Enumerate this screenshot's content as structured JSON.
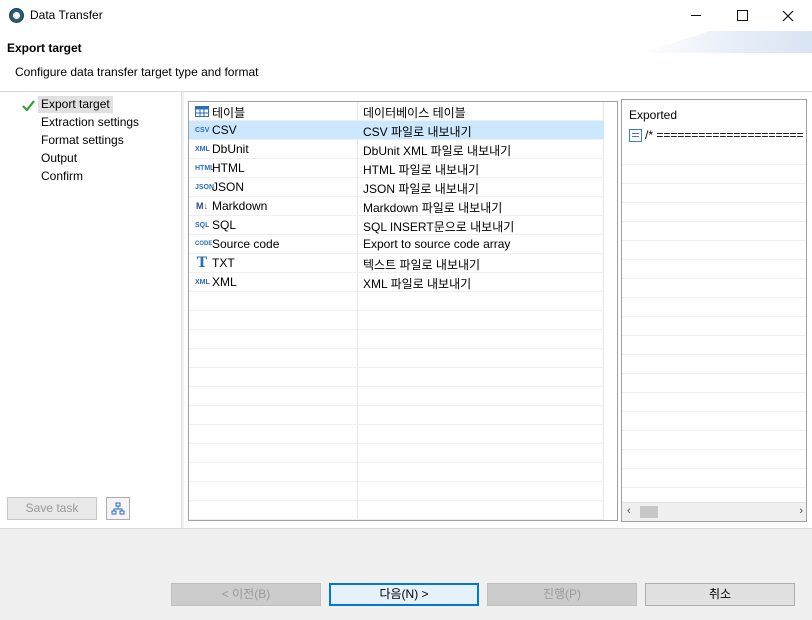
{
  "window": {
    "title": "Data Transfer"
  },
  "header": {
    "title": "Export target",
    "description": "Configure data transfer target type and format"
  },
  "steps": [
    {
      "label": "Export target",
      "active": true
    },
    {
      "label": "Extraction settings",
      "active": false
    },
    {
      "label": "Format settings",
      "active": false
    },
    {
      "label": "Output",
      "active": false
    },
    {
      "label": "Confirm",
      "active": false
    }
  ],
  "left_buttons": {
    "save_task": "Save task"
  },
  "formats": [
    {
      "icon": "table-icon",
      "name": "테이블",
      "description": "데이터베이스 테이블"
    },
    {
      "icon": "csv-icon",
      "name": "CSV",
      "description": "CSV 파일로 내보내기"
    },
    {
      "icon": "xml-icon",
      "name": "DbUnit",
      "description": "DbUnit XML 파일로 내보내기"
    },
    {
      "icon": "html-icon",
      "name": "HTML",
      "description": "HTML 파일로 내보내기"
    },
    {
      "icon": "json-icon",
      "name": "JSON",
      "description": "JSON 파일로 내보내기"
    },
    {
      "icon": "markdown-icon",
      "name": "Markdown",
      "description": "Markdown 파일로 내보내기"
    },
    {
      "icon": "sql-icon",
      "name": "SQL",
      "description": "SQL INSERT문으로 내보내기"
    },
    {
      "icon": "code-icon",
      "name": "Source code",
      "description": "Export to source code array"
    },
    {
      "icon": "txt-icon",
      "name": "TXT",
      "description": "텍스트 파일로 내보내기"
    },
    {
      "icon": "xml-icon",
      "name": "XML",
      "description": "XML 파일로 내보내기"
    }
  ],
  "selected_format": "CSV",
  "preview": {
    "label": "Exported",
    "item": "/* ====================="
  },
  "footer": {
    "back": "< 이전(B)",
    "next": "다음(N) >",
    "proceed": "진행(P)",
    "cancel": "취소"
  },
  "colors": {
    "selection": "#cce8ff",
    "accent": "#0078d7",
    "check": "#3a9a3a"
  }
}
